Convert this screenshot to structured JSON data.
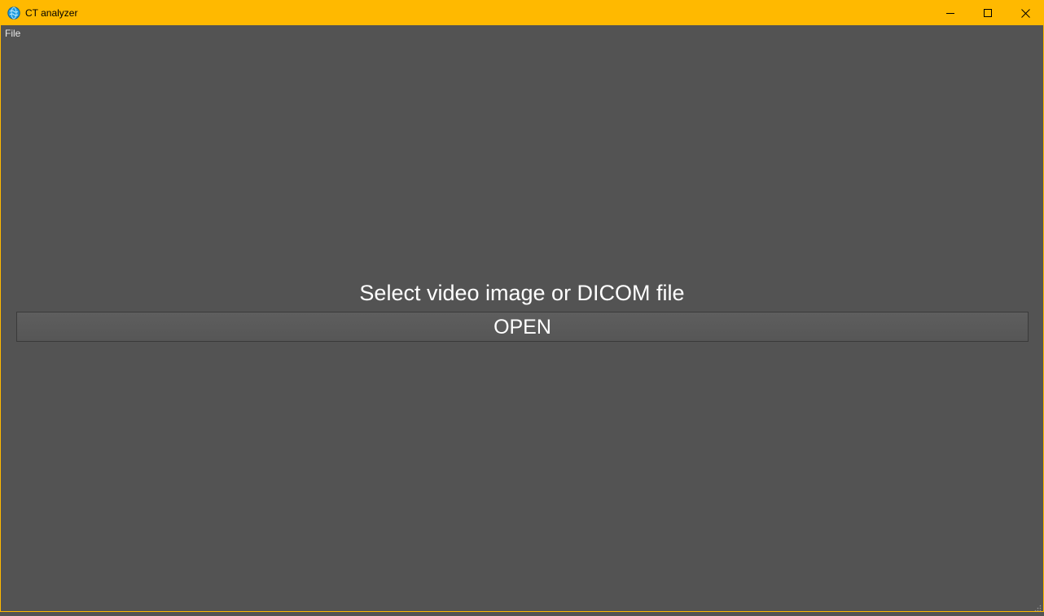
{
  "window": {
    "title": "CT analyzer",
    "accent_color": "#ffb900",
    "background_color": "#535353",
    "icon": "app-globe-icon"
  },
  "title_buttons": {
    "minimize_icon": "minimize-icon",
    "maximize_icon": "maximize-icon",
    "close_icon": "close-icon"
  },
  "menubar": {
    "items": [
      {
        "label": "File"
      }
    ]
  },
  "main": {
    "prompt": "Select video image or DICOM file",
    "open_button_label": "OPEN"
  }
}
